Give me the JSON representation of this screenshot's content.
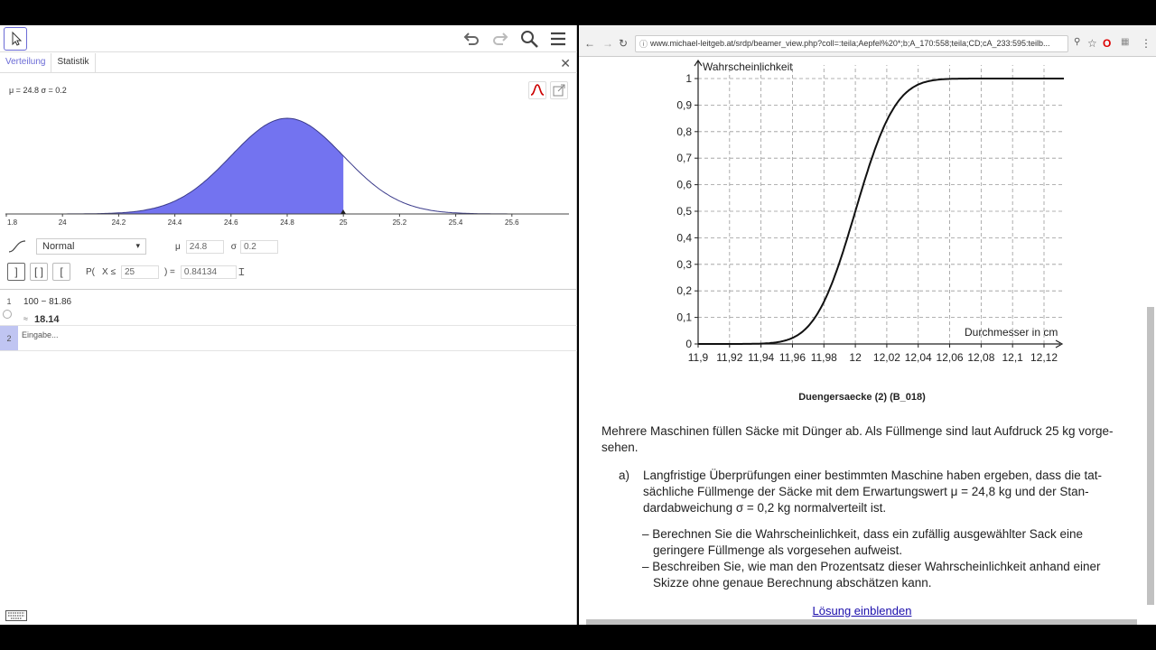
{
  "geogebra": {
    "tabs": [
      "Verteilung",
      "Statistik"
    ],
    "params_label": "μ = 24.8 σ = 0.2",
    "x_ticks": [
      "1.8",
      "24",
      "24.2",
      "24.4",
      "24.6",
      "24.8",
      "25",
      "25.2",
      "25.4",
      "25.6"
    ],
    "distribution": "Normal",
    "mu_label": "μ",
    "mu_value": "24.8",
    "sigma_label": "σ",
    "sigma_value": "0.2",
    "prob_prefix": "P(",
    "prob_var": "X ≤",
    "prob_bound": "25",
    "prob_suffix": ") =",
    "prob_result": "0.84134",
    "algebra": [
      {
        "num": "1",
        "input": "100 − 81.86",
        "approx": "≈",
        "result": "18.14"
      },
      {
        "num": "2",
        "placeholder": "Eingabe..."
      }
    ],
    "accent_color": "#7373f0"
  },
  "browser": {
    "url": "www.michael-leitgeb.at/srdp/beamer_view.php?coll=:teila;Aepfel%20*;b;A_170:558;teila;CD;cA_233:595:teilb..."
  },
  "doc": {
    "graph": {
      "ylabel": "Wahrscheinlichkeit",
      "xlabel": "Durchmesser in cm",
      "y_ticks": [
        "0",
        "0,1",
        "0,2",
        "0,3",
        "0,4",
        "0,5",
        "0,6",
        "0,7",
        "0,8",
        "0,9",
        "1"
      ],
      "x_ticks": [
        "11,9",
        "11,92",
        "11,94",
        "11,96",
        "11,98",
        "12",
        "12,02",
        "12,04",
        "12,06",
        "12,08",
        "12,1",
        "12,12"
      ]
    },
    "title": "Duengersaecke (2) (B_018)",
    "intro_1": "Mehrere Maschinen füllen Säcke mit Dünger ab. Als Füllmenge sind laut Aufdruck 25 kg vorge-",
    "intro_2": "sehen.",
    "a_label": "a)",
    "a_1": "Langfristige Überprüfungen einer bestimmten Maschine haben ergeben, dass die tat-",
    "a_2": "sächliche Füllmenge der Säcke mit dem Erwartungswert μ = 24,8 kg und der Stan-",
    "a_3": "dardabweichung σ = 0,2 kg normalverteilt ist.",
    "b1_1": "– Berechnen Sie die Wahrscheinlichkeit, dass ein zufällig ausgewählter Sack eine",
    "b1_2": "geringere Füllmenge als vorgesehen aufweist.",
    "b2_1": "– Beschreiben Sie, wie man den Prozentsatz dieser Wahrscheinlichkeit anhand einer",
    "b2_2": "Skizze ohne genaue Berechnung abschätzen kann.",
    "link": "Lösung einblenden"
  }
}
